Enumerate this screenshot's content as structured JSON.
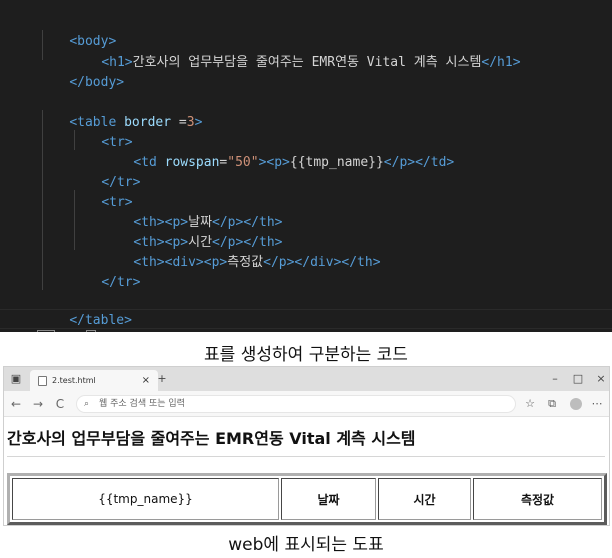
{
  "editor": {
    "lines": {
      "l1": {
        "open": "<",
        "tag": "body",
        "close": ">"
      },
      "l2": {
        "tag_open": "<h1>",
        "text": "간호사의 업무부담을 줄여주는 EMR연동 Vital 계측 시스템",
        "tag_close": "</h1>"
      },
      "l3": {
        "text": "</body>"
      },
      "l5": {
        "tag": "<table",
        "attr": "border",
        "eq": " =",
        "val": "3",
        "close": ">"
      },
      "l6": {
        "text": "<tr>"
      },
      "l7": {
        "tag": "<td",
        "attr": "rowspan",
        "eq": "=",
        "val": "\"50\"",
        "close": ">",
        "p_open": "<p>",
        "text": "{{tmp_name}}",
        "p_close": "</p>",
        "td_close": "</td>"
      },
      "l8": {
        "text": "</tr>"
      },
      "l9": {
        "text": "<tr>"
      },
      "l10": {
        "open": "<th><p>",
        "text": "날짜",
        "close": "</p></th>"
      },
      "l11": {
        "open": "<th><p>",
        "text": "시간",
        "close": "</p></th>"
      },
      "l12": {
        "open": "<th><div><p>",
        "text": "측정값",
        "close": "</p></div></th>"
      },
      "l13": {
        "text": "</tr>"
      },
      "l15": {
        "text": "</table>"
      },
      "l16": {
        "lt_slash": "</",
        "tag": "html",
        "gt": ">"
      }
    }
  },
  "captions": {
    "top": "표를 생성하여 구분하는 코드",
    "bottom": "web에 표시되는 도표"
  },
  "browser": {
    "tab_title": "2.test.html",
    "tab_close": "×",
    "new_tab": "+",
    "window_buttons": {
      "minimize": "–",
      "maximize": "□",
      "close": "×"
    },
    "nav": {
      "back": "←",
      "forward": "→",
      "refresh": "C"
    },
    "address_placeholder": "웹 주소 검색 또는 입력",
    "page": {
      "heading": "간호사의 업무부담을 줄여주는 EMR연동 Vital 계측 시스템",
      "table": {
        "cell": "{{tmp_name}}",
        "headers": [
          "날짜",
          "시간",
          "측정값"
        ]
      }
    }
  }
}
